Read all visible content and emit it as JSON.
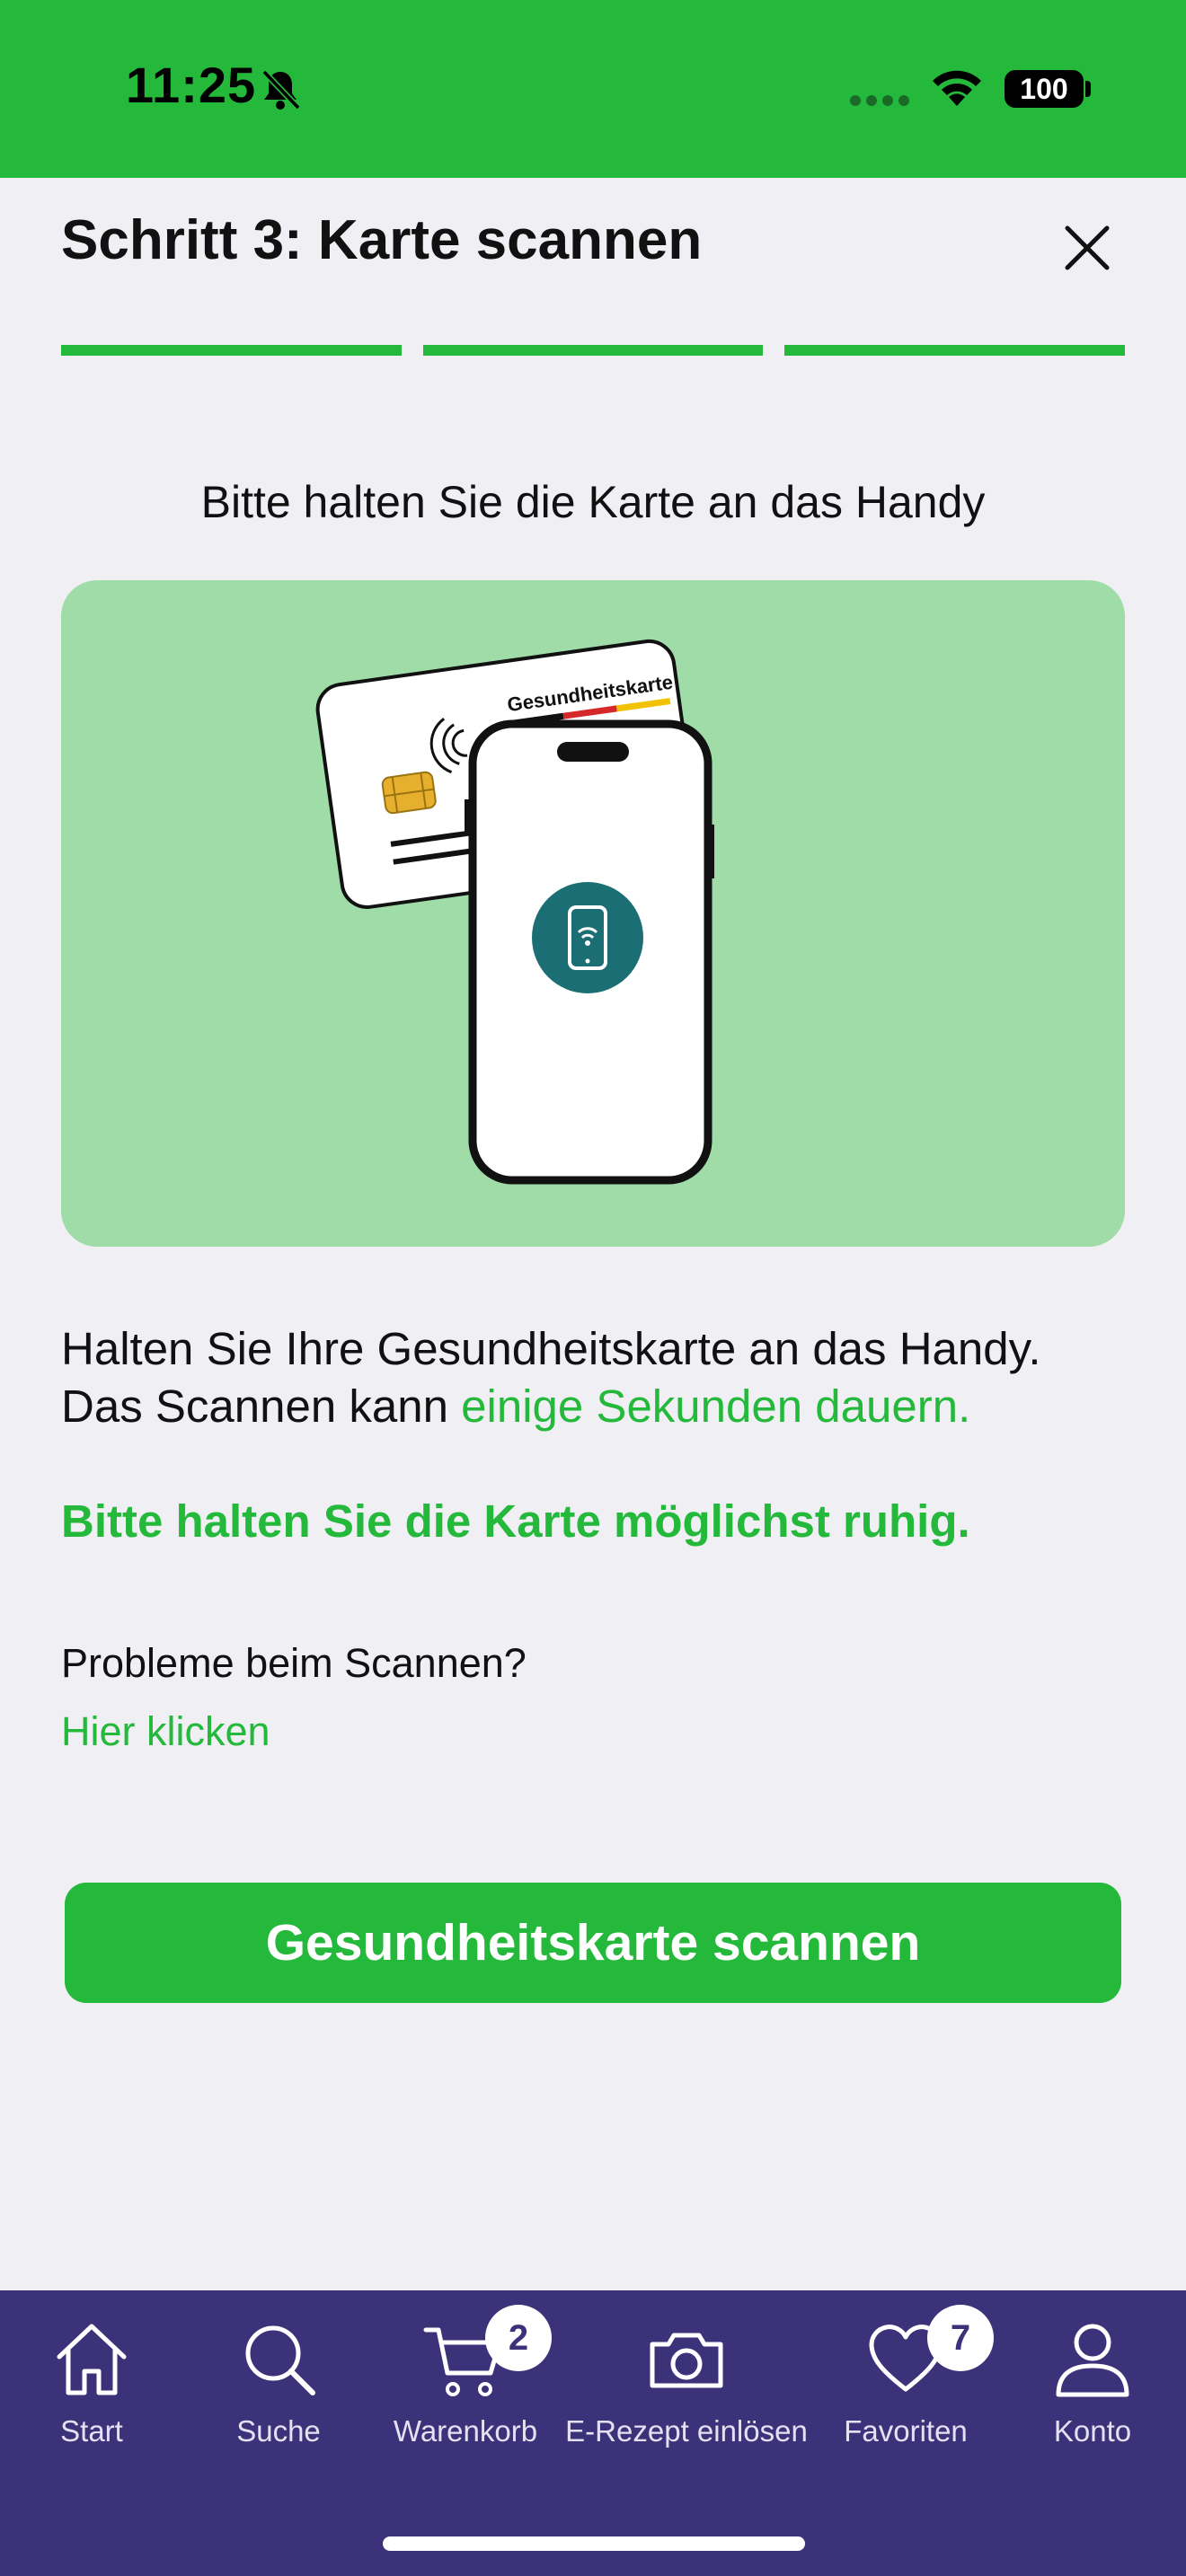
{
  "status_bar": {
    "time": "11:25",
    "battery": "100",
    "icons": [
      "bell-slash-icon",
      "signal-icon",
      "wifi-icon",
      "battery-icon"
    ]
  },
  "header": {
    "title": "Schritt 3: Karte scannen",
    "close_icon": "close-icon",
    "progress_steps_completed": 3,
    "progress_steps_total": 3
  },
  "instruction": {
    "heading": "Bitte halten Sie die Karte an das Handy",
    "card_label": "Gesundheitskarte",
    "body_line1": "Halten Sie Ihre Gesundheitskarte an das Handy.",
    "body_line2_prefix": "Das Scannen kann ",
    "body_line2_highlight": "einige Sekunden dauern.",
    "hint": "Bitte halten Sie die Karte möglichst ruhig."
  },
  "help": {
    "question": "Probleme beim Scannen?",
    "link": "Hier klicken"
  },
  "scan_button": {
    "label": "Gesundheitskarte scannen"
  },
  "bottom_nav": {
    "items": [
      {
        "label": "Start",
        "icon": "home-icon"
      },
      {
        "label": "Suche",
        "icon": "search-icon"
      },
      {
        "label": "Warenkorb",
        "icon": "cart-icon",
        "badge": "2"
      },
      {
        "label": "E-Rezept einlösen",
        "icon": "camera-icon"
      },
      {
        "label": "Favoriten",
        "icon": "heart-icon",
        "badge": "7"
      },
      {
        "label": "Konto",
        "icon": "user-icon"
      }
    ]
  },
  "colors": {
    "accent": "#25b93c",
    "nav_background": "#3c327a",
    "illustration_background": "#a0dca8",
    "page_background": "#efeff4"
  }
}
